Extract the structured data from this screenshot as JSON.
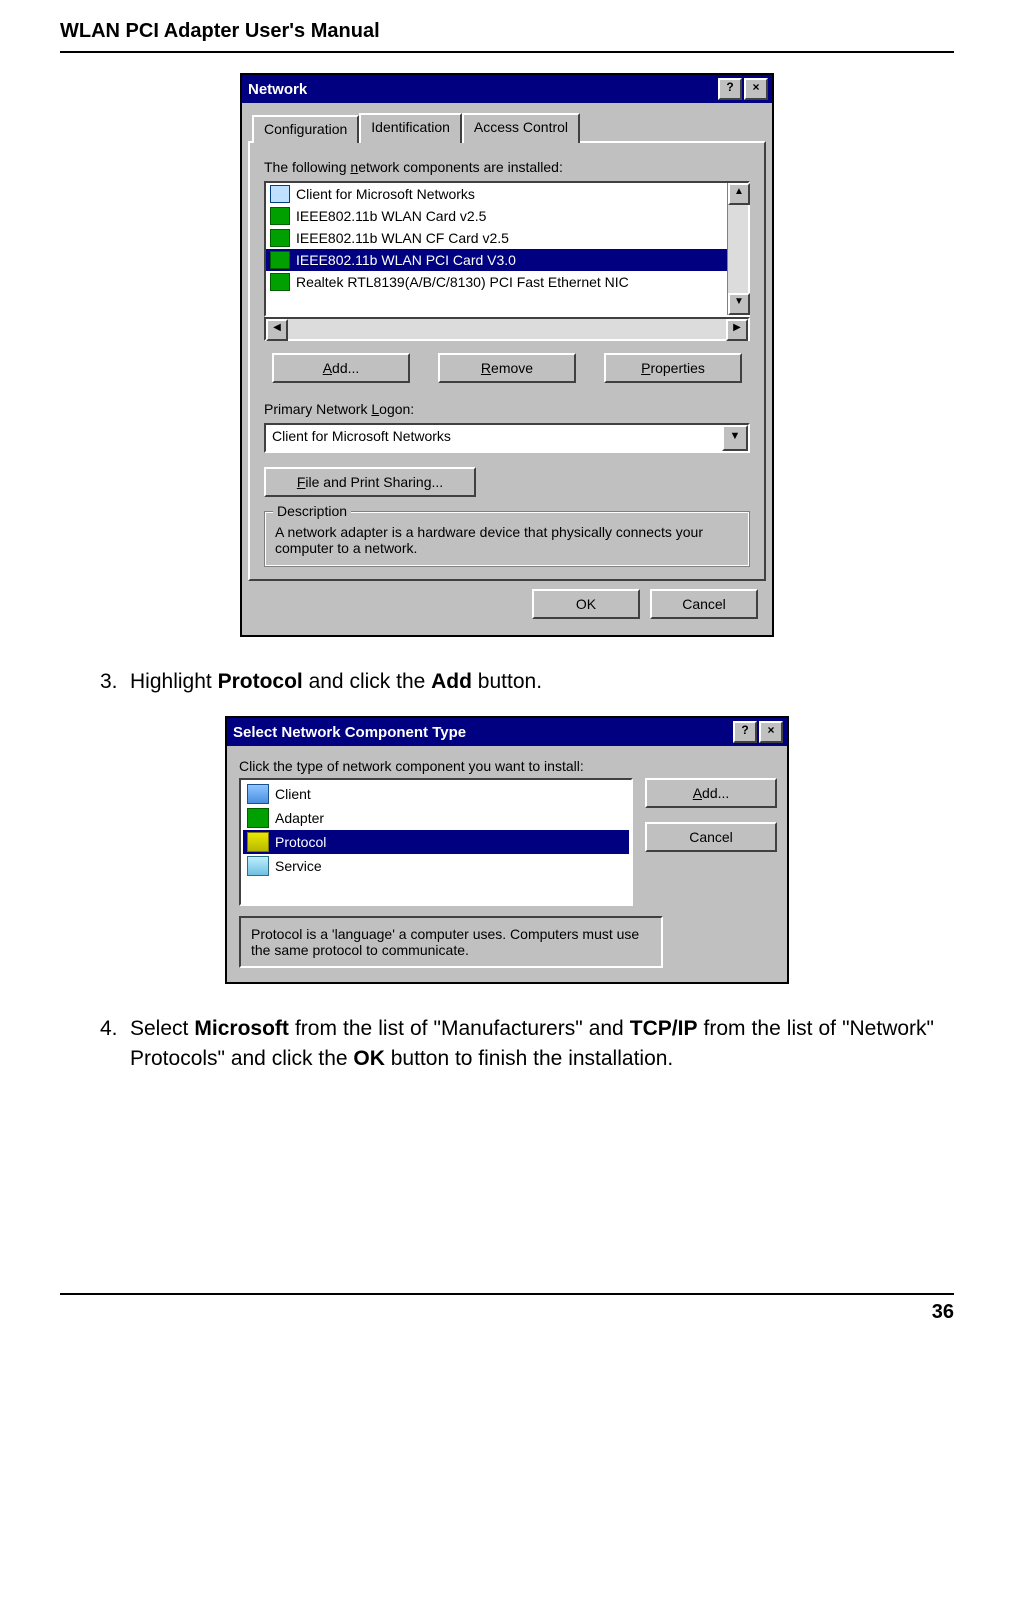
{
  "header": {
    "title": "WLAN PCI Adapter User's Manual"
  },
  "footer": {
    "page": "36"
  },
  "step3": {
    "num": "3.",
    "text_a": "Highlight ",
    "bold_a": "Protocol",
    "text_b": " and click the ",
    "bold_b": "Add",
    "text_c": " button."
  },
  "step4": {
    "num": "4.",
    "text_a": "Select ",
    "bold_a": "Microsoft",
    "text_b": " from the list of \"Manufacturers\" and ",
    "bold_b": "TCP/IP",
    "text_c": " from the list of \"Network\" Protocols\" and click the ",
    "bold_c": "OK",
    "text_d": " button to finish the installation."
  },
  "dlg1": {
    "title": "Network",
    "help": "?",
    "close": "×",
    "tabs": {
      "t1": "Configuration",
      "t2": "Identification",
      "t3": "Access Control"
    },
    "lbl_components_a": "The following ",
    "lbl_components_u": "n",
    "lbl_components_b": "etwork components are installed:",
    "items": [
      "Client for Microsoft Networks",
      "IEEE802.11b WLAN Card v2.5",
      "IEEE802.11b WLAN CF Card v2.5",
      "IEEE802.11b WLAN PCI Card V3.0",
      "Realtek RTL8139(A/B/C/8130) PCI Fast Ethernet NIC"
    ],
    "btn_add_u": "A",
    "btn_add_t": "dd...",
    "btn_remove_u": "R",
    "btn_remove_t": "emove",
    "btn_props_u": "P",
    "btn_props_pre": "",
    "btn_props_t": "roperties",
    "lbl_logon_a": "Primary Network ",
    "lbl_logon_u": "L",
    "lbl_logon_b": "ogon:",
    "combo_value": "Client for Microsoft Networks",
    "btn_fps_u": "F",
    "btn_fps_t": "ile and Print Sharing...",
    "grp_desc": "Description",
    "desc_text": "A network adapter is a hardware device that physically connects your computer to a network.",
    "btn_ok": "OK",
    "btn_cancel": "Cancel",
    "up": "▲",
    "dn": "▼",
    "lt": "◀",
    "rt": "▶"
  },
  "dlg2": {
    "title": "Select Network Component Type",
    "help": "?",
    "close": "×",
    "lbl": "Click the type of network component you want to install:",
    "items": [
      "Client",
      "Adapter",
      "Protocol",
      "Service"
    ],
    "btn_add_u": "A",
    "btn_add_t": "dd...",
    "btn_cancel": "Cancel",
    "desc": "Protocol is a 'language' a computer uses. Computers must use the same protocol to communicate."
  }
}
